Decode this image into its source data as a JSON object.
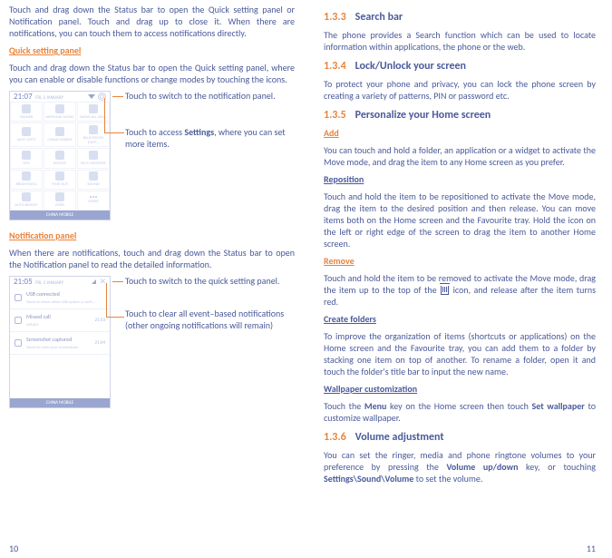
{
  "left": {
    "intro": "Touch and drag down the Status bar to open the Quick setting panel or Notification panel. Touch and drag up to close it. When there are notifications, you can touch them to access notifications directly.",
    "quick_heading": "Quick setting panel",
    "quick_body": "Touch and drag down the Status bar to open the Quick setting panel, where you can enable or disable functions or change modes by touching the icons.",
    "shot1": {
      "time": "21:07",
      "date": "FRI, 2 JANUARY",
      "tiles": [
        "OWNER",
        "AIRPLANE MODE",
        "SHOW ALL DEV...",
        "WI-FI (OFF)",
        "CHINA MOBILE",
        "BLUETOOTH (NOT...",
        "GPS",
        "ROTATE",
        "WI-FI HOTSPOT",
        "BRIGHTNESS",
        "TIME OUT",
        "SOUND",
        "AUTO BRIGHT",
        "GYRO"
      ],
      "more": "MORE",
      "carrier": "CHINA MOBILE"
    },
    "callout1": "Touch to switch to the notification panel.",
    "callout2_pre": "Touch to access ",
    "callout2_bold": "Settings",
    "callout2_post": ", where you can set more items.",
    "notif_heading": "Notification panel",
    "notif_body": "When there are notifications, touch and drag down the Status bar to open the Notification panel to read the detailed information.",
    "shot2": {
      "time": "21:05",
      "date": "FRI, 2 JANUARY",
      "rows": [
        {
          "title": "USB connected",
          "sub": "Touch to show other USB option a, such...",
          "right": ""
        },
        {
          "title": "Missed call",
          "sub": "456401",
          "right": "21:03"
        },
        {
          "title": "Screenshot captured",
          "sub": "Touch to view your screenshots",
          "right": "21:04"
        }
      ],
      "carrier": "CHINA MOBILE"
    },
    "callout3": "Touch to switch to the quick setting panel.",
    "callout4": "Touch to clear all event–based notifications (other ongoing notifications will remain)",
    "pagenum": "10"
  },
  "right": {
    "s133_num": "1.3.3",
    "s133_title": "Search bar",
    "s133_body": "The phone provides a Search function which can be used to locate information within applications, the phone or the web.",
    "s134_num": "1.3.4",
    "s134_title": "Lock/Unlock your screen",
    "s134_body": "To protect your phone and privacy, you can lock the phone screen by creating a variety of patterns, PIN or password etc.",
    "s135_num": "1.3.5",
    "s135_title": "Personalize your Home screen",
    "add_h": "Add",
    "add_body": "You can touch and hold a folder, an application or a widget to activate the Move mode, and drag the item to any Home screen as you prefer.",
    "repo_h": "Reposition",
    "repo_body": "Touch and hold the item to be repositioned to activate the Move mode, drag the item to the desired position and then release.  You can move items both on the Home screen and the Favourite tray. Hold the icon on the left or right edge of the screen to drag the item to another Home screen.",
    "remove_h": "Remove",
    "remove_body_pre": "Touch and hold the item to be removed to activate the Move mode, drag the item up to the top of the ",
    "remove_body_post": " icon, and release after the item turns red.",
    "folders_h": "Create folders",
    "folders_body": "To improve the organization of items (shortcuts or applications) on the Home screen and the Favourite tray, you can add them to a folder by stacking one item on top of another. To rename a folder, open it and touch the folder's title bar to input the new name.",
    "wall_h": "Wallpaper customization",
    "wall_pre": "Touch the ",
    "wall_menu": "Menu",
    "wall_mid": " key on the Home screen then touch ",
    "wall_set": "Set wallpaper",
    "wall_post": " to customize wallpaper.",
    "s136_num": "1.3.6",
    "s136_title": "Volume adjustment",
    "vol_pre": "You can set the ringer, media and phone ringtone volumes to your preference by pressing the ",
    "vol_key": "Volume up/down",
    "vol_mid": " key, or touching ",
    "vol_path": "Settings\\Sound\\Volume",
    "vol_post": " to set the volume.",
    "pagenum": "11"
  }
}
